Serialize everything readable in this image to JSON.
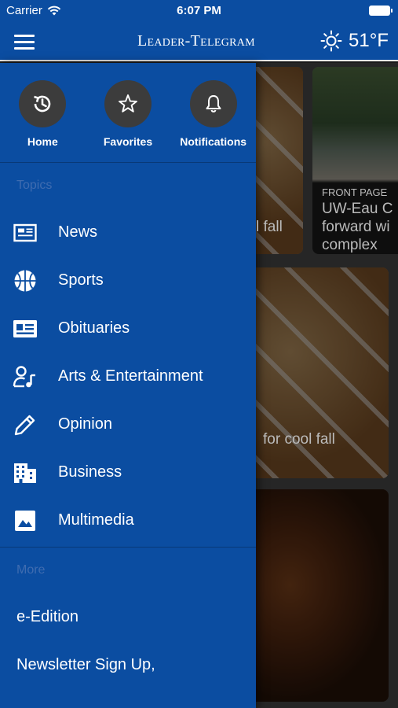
{
  "status_bar": {
    "carrier": "Carrier",
    "time": "6:07 PM"
  },
  "header": {
    "logo": "Leader-Telegram",
    "temperature": "51°F"
  },
  "quick_links": [
    {
      "label": "Home",
      "icon": "history-icon"
    },
    {
      "label": "Favorites",
      "icon": "star-icon"
    },
    {
      "label": "Notifications",
      "icon": "bell-icon"
    }
  ],
  "topics": {
    "heading": "Topics",
    "items": [
      {
        "label": "News",
        "icon": "newspaper-icon"
      },
      {
        "label": "Sports",
        "icon": "basketball-icon"
      },
      {
        "label": "Obituaries",
        "icon": "id-card-icon"
      },
      {
        "label": "Arts & Entertainment",
        "icon": "person-music-icon"
      },
      {
        "label": "Opinion",
        "icon": "pencil-icon"
      },
      {
        "label": "Business",
        "icon": "building-icon"
      },
      {
        "label": "Multimedia",
        "icon": "image-icon"
      }
    ]
  },
  "more": {
    "heading": "More",
    "items": [
      {
        "label": "e-Edition"
      },
      {
        "label": "Newsletter Sign Up,"
      }
    ]
  },
  "background": {
    "card1_text": "l fall",
    "card2_tag": "FRONT PAGE",
    "card2_title_line1": "UW-Eau C",
    "card2_title_line2": "forward wi",
    "card2_title_line3": "complex",
    "card3_text": "for cool fall"
  },
  "colors": {
    "brand_blue": "#0b4da1",
    "circle_bg": "#3c3c3c",
    "section_label": "#3f6cb0"
  }
}
